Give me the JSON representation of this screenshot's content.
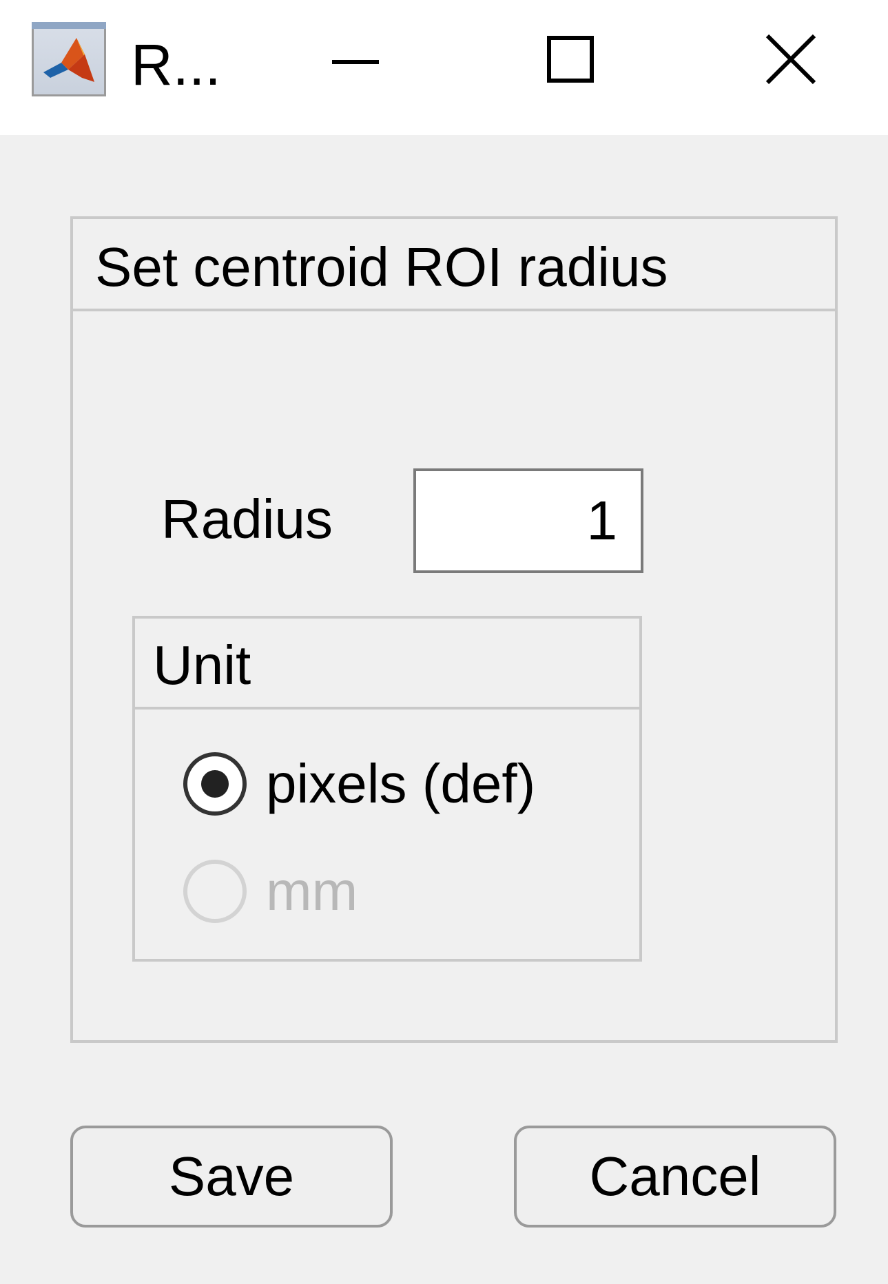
{
  "window": {
    "title": "R...",
    "icon": "matlab-icon",
    "controls": {
      "minimize": "minimize-icon",
      "maximize": "maximize-icon",
      "close": "close-icon"
    }
  },
  "panel": {
    "title": "Set centroid ROI radius",
    "radius_label": "Radius",
    "radius_value": "1",
    "unit": {
      "title": "Unit",
      "options": [
        {
          "label": "pixels (def)",
          "selected": true,
          "enabled": true
        },
        {
          "label": "mm",
          "selected": false,
          "enabled": false
        }
      ]
    }
  },
  "buttons": {
    "save": "Save",
    "cancel": "Cancel"
  }
}
